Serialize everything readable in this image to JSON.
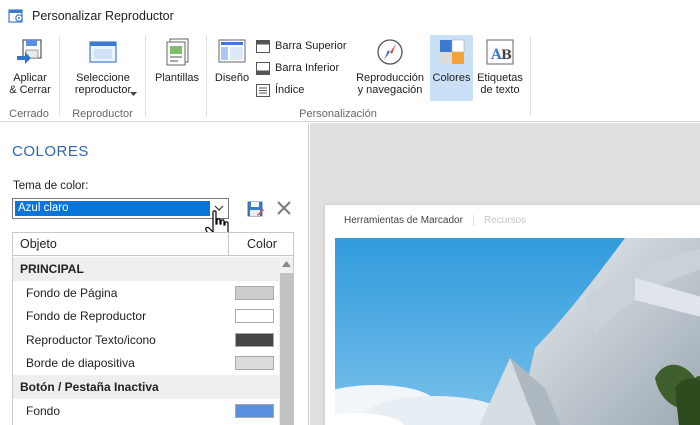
{
  "window": {
    "title": "Personalizar Reproductor"
  },
  "ribbon": {
    "groups": [
      {
        "label": "Cerrado"
      },
      {
        "label": "Reproductor"
      },
      {
        "label": "Personalización"
      }
    ],
    "buttons": {
      "apply": "Aplicar\n& Cerrar",
      "select_player": "Seleccione\nreproductor",
      "templates": "Plantillas",
      "design": "Diseño",
      "top_bar": "Barra Superior",
      "bottom_bar": "Barra Inferior",
      "index": "Índice",
      "playback": "Reproducción\ny navegación",
      "colors": "Colores",
      "text_labels": "Etiquetas\nde texto"
    }
  },
  "panel": {
    "title": "COLORES",
    "theme_label": "Tema de color:",
    "theme_value": "Azul claro",
    "grid": {
      "col_object": "Objeto",
      "col_color": "Color",
      "rows": [
        {
          "type": "section",
          "label": "PRINCIPAL"
        },
        {
          "type": "item",
          "label": "Fondo de Página",
          "color": "#cdcdcd"
        },
        {
          "type": "item",
          "label": "Fondo de Reproductor",
          "color": "#ffffff"
        },
        {
          "type": "item",
          "label": "Reproductor Texto/icono",
          "color": "#464646"
        },
        {
          "type": "item",
          "label": "Borde de diapositiva",
          "color": "#dcdcdc"
        },
        {
          "type": "section",
          "label": "Botón / Pestaña Inactiva"
        },
        {
          "type": "item",
          "label": "Fondo",
          "color": "#5b8fdf"
        }
      ]
    }
  },
  "preview": {
    "tab_active": "Herramientas de Marcador",
    "tab_inactive": "Recursos"
  },
  "colors": {
    "accent": "#2e66b5",
    "selection": "#0a75d8",
    "active_button": "#c9e0f7",
    "preview_bg": "#dfe0e1"
  }
}
